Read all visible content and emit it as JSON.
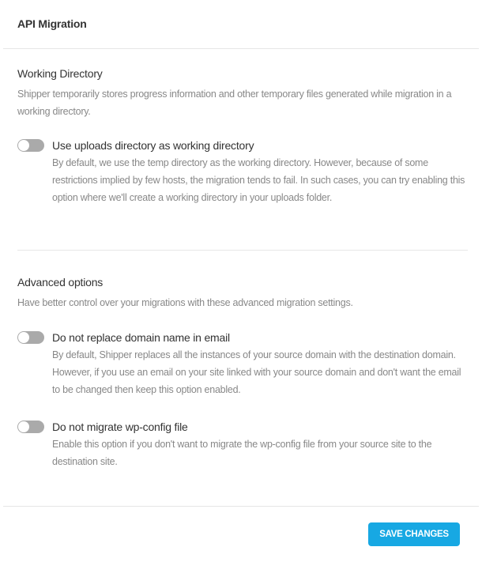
{
  "header": {
    "title": "API Migration"
  },
  "working_directory": {
    "title": "Working Directory",
    "description": "Shipper temporarily stores progress information and other temporary files generated while migration in a working directory.",
    "options": [
      {
        "label": "Use uploads directory as working directory",
        "description": "By default, we use the temp directory as the working directory. However, because of some restrictions implied by few hosts, the migration tends to fail. In such cases, you can try enabling this option where we'll create a working directory in your uploads folder.",
        "enabled": false
      }
    ]
  },
  "advanced_options": {
    "title": "Advanced options",
    "description": "Have better control over your migrations with these advanced migration settings.",
    "options": [
      {
        "label": "Do not replace domain name in email",
        "description": "By default, Shipper replaces all the instances of your source domain with the destination domain. However, if you use an email on your site linked with your source domain and don't want the email to be changed then keep this option enabled.",
        "enabled": false
      },
      {
        "label": "Do not migrate wp-config file",
        "description": "Enable this option if you don't want to migrate the wp-config file from your source site to the destination site.",
        "enabled": false
      }
    ]
  },
  "footer": {
    "save_label": "SAVE CHANGES"
  },
  "colors": {
    "accent": "#17a8e3",
    "toggle_off": "#aaaaaa",
    "muted_text": "#888888",
    "divider": "#e6e6e6"
  }
}
